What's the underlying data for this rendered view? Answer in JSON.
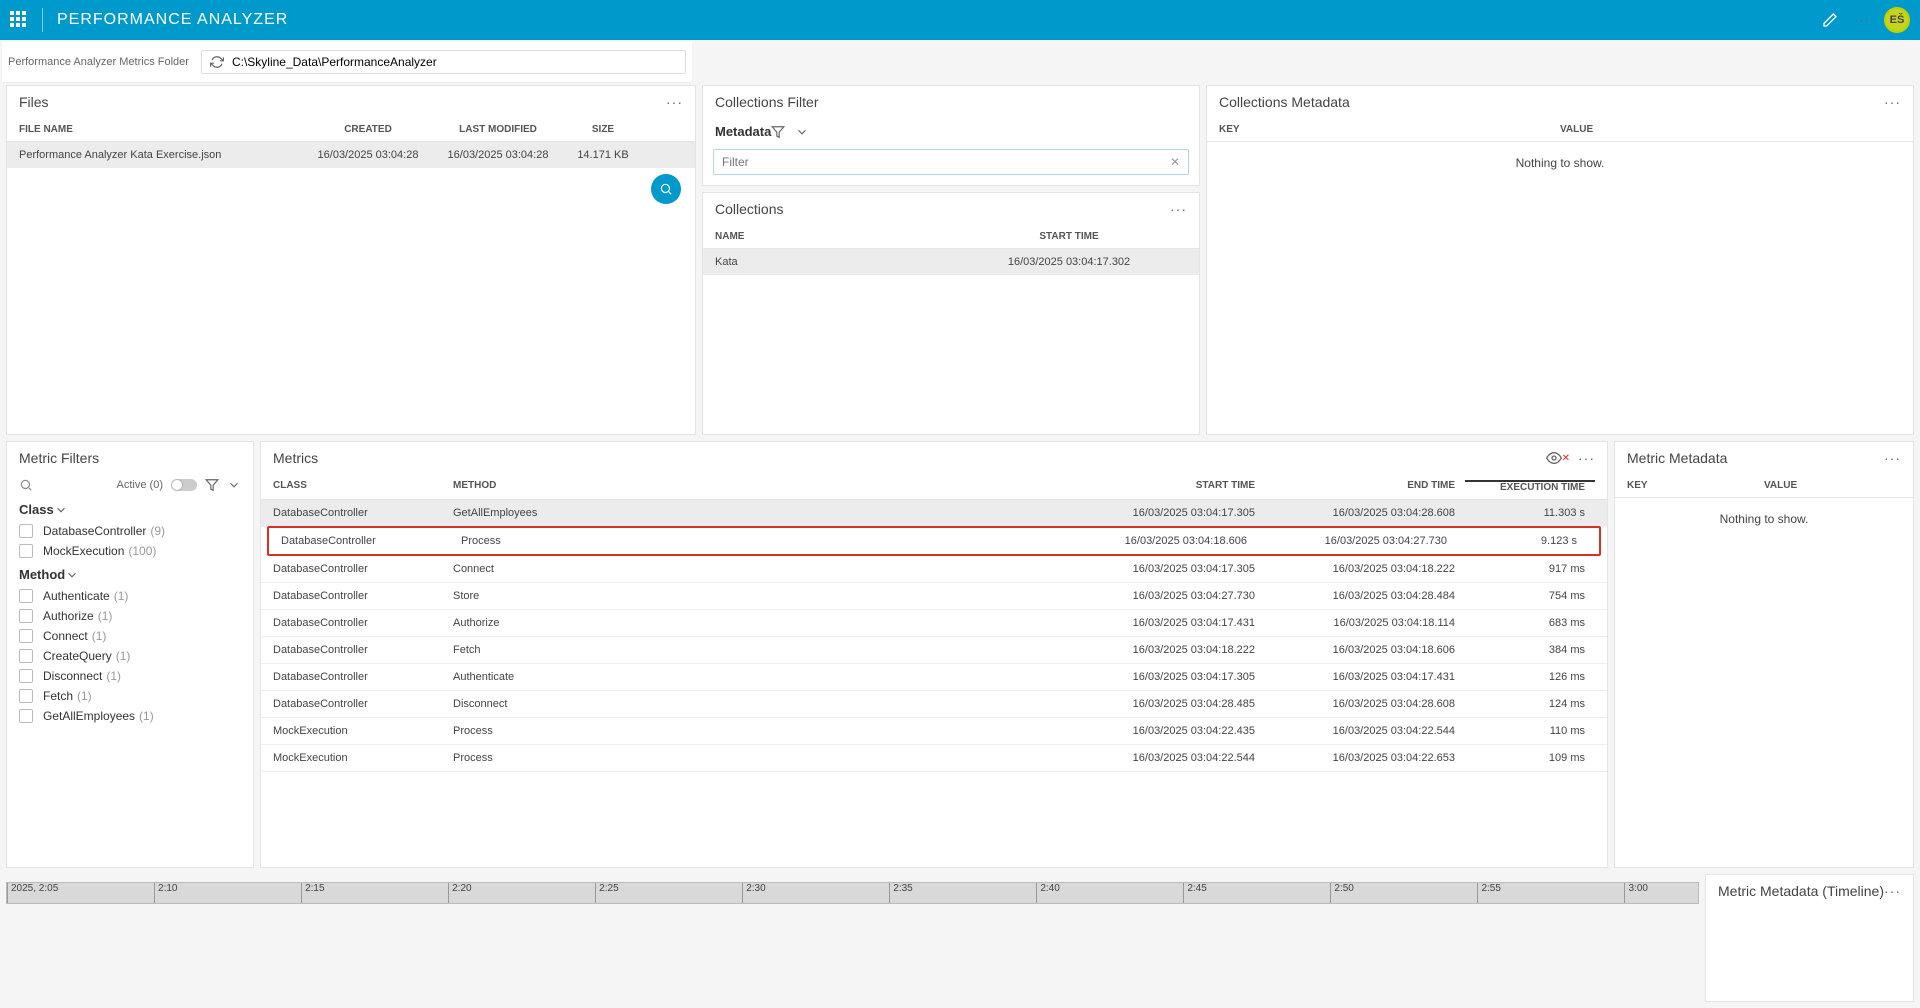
{
  "app_title": "PERFORMANCE ANALYZER",
  "avatar_initials": "EŠ",
  "folder": {
    "label": "Performance Analyzer Metrics Folder",
    "path": "C:\\Skyline_Data\\PerformanceAnalyzer"
  },
  "files": {
    "title": "Files",
    "cols": {
      "name": "FILE NAME",
      "created": "CREATED",
      "modified": "LAST MODIFIED",
      "size": "SIZE"
    },
    "rows": [
      {
        "name": "Performance Analyzer Kata Exercise.json",
        "created": "16/03/2025 03:04:28",
        "modified": "16/03/2025 03:04:28",
        "size": "14.171 KB"
      }
    ]
  },
  "coll_filter": {
    "title": "Collections Filter",
    "metadata_label": "Metadata",
    "filter_placeholder": "Filter"
  },
  "collections": {
    "title": "Collections",
    "cols": {
      "name": "NAME",
      "start": "START TIME"
    },
    "rows": [
      {
        "name": "Kata",
        "start": "16/03/2025 03:04:17.302"
      }
    ]
  },
  "coll_meta": {
    "title": "Collections Metadata",
    "cols": {
      "key": "KEY",
      "value": "VALUE"
    },
    "nothing": "Nothing to show."
  },
  "metric_filters": {
    "title": "Metric Filters",
    "active_label": "Active (0)",
    "class_label": "Class",
    "method_label": "Method",
    "classes": [
      {
        "label": "DatabaseController",
        "count": "(9)"
      },
      {
        "label": "MockExecution",
        "count": "(100)"
      }
    ],
    "methods": [
      {
        "label": "Authenticate",
        "count": "(1)"
      },
      {
        "label": "Authorize",
        "count": "(1)"
      },
      {
        "label": "Connect",
        "count": "(1)"
      },
      {
        "label": "CreateQuery",
        "count": "(1)"
      },
      {
        "label": "Disconnect",
        "count": "(1)"
      },
      {
        "label": "Fetch",
        "count": "(1)"
      },
      {
        "label": "GetAllEmployees",
        "count": "(1)"
      }
    ]
  },
  "metrics": {
    "title": "Metrics",
    "cols": {
      "cls": "CLASS",
      "method": "METHOD",
      "start": "START TIME",
      "end": "END TIME",
      "exec": "EXECUTION TIME"
    },
    "rows": [
      {
        "cls": "DatabaseController",
        "method": "GetAllEmployees",
        "start": "16/03/2025 03:04:17.305",
        "end": "16/03/2025 03:04:28.608",
        "exec": "11.303 s",
        "sel": true
      },
      {
        "cls": "DatabaseController",
        "method": "Process",
        "start": "16/03/2025 03:04:18.606",
        "end": "16/03/2025 03:04:27.730",
        "exec": "9.123 s",
        "hl": true
      },
      {
        "cls": "DatabaseController",
        "method": "Connect",
        "start": "16/03/2025 03:04:17.305",
        "end": "16/03/2025 03:04:18.222",
        "exec": "917 ms"
      },
      {
        "cls": "DatabaseController",
        "method": "Store",
        "start": "16/03/2025 03:04:27.730",
        "end": "16/03/2025 03:04:28.484",
        "exec": "754 ms"
      },
      {
        "cls": "DatabaseController",
        "method": "Authorize",
        "start": "16/03/2025 03:04:17.431",
        "end": "16/03/2025 03:04:18.114",
        "exec": "683 ms"
      },
      {
        "cls": "DatabaseController",
        "method": "Fetch",
        "start": "16/03/2025 03:04:18.222",
        "end": "16/03/2025 03:04:18.606",
        "exec": "384 ms"
      },
      {
        "cls": "DatabaseController",
        "method": "Authenticate",
        "start": "16/03/2025 03:04:17.305",
        "end": "16/03/2025 03:04:17.431",
        "exec": "126 ms"
      },
      {
        "cls": "DatabaseController",
        "method": "Disconnect",
        "start": "16/03/2025 03:04:28.485",
        "end": "16/03/2025 03:04:28.608",
        "exec": "124 ms"
      },
      {
        "cls": "MockExecution",
        "method": "Process",
        "start": "16/03/2025 03:04:22.435",
        "end": "16/03/2025 03:04:22.544",
        "exec": "110 ms"
      },
      {
        "cls": "MockExecution",
        "method": "Process",
        "start": "16/03/2025 03:04:22.544",
        "end": "16/03/2025 03:04:22.653",
        "exec": "109 ms"
      }
    ]
  },
  "metric_meta": {
    "title": "Metric Metadata",
    "cols": {
      "key": "KEY",
      "value": "VALUE"
    },
    "nothing": "Nothing to show."
  },
  "metric_meta_timeline": {
    "title": "Metric Metadata (Timeline)"
  },
  "timeline": {
    "ticks": [
      "2025, 2:05",
      "2:10",
      "2:15",
      "2:20",
      "2:25",
      "2:30",
      "2:35",
      "2:40",
      "2:45",
      "2:50",
      "2:55",
      "3:00"
    ]
  }
}
